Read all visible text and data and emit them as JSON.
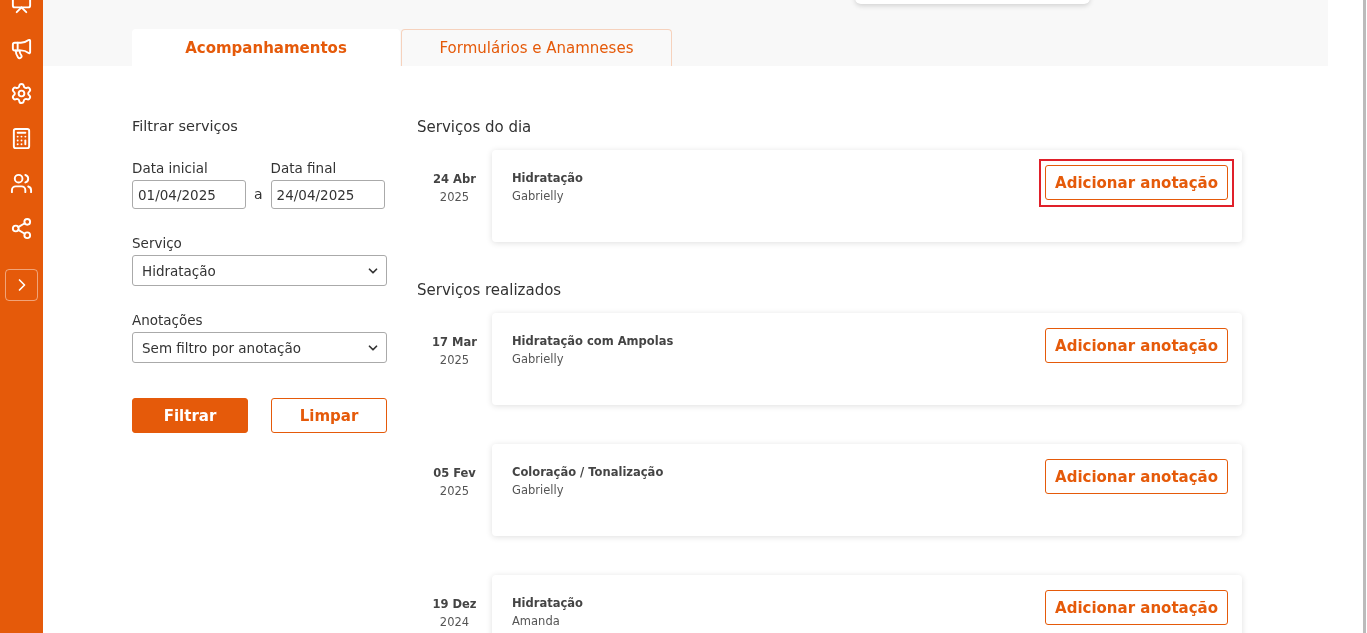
{
  "sidebar": {
    "items": [
      {
        "kind": "chart"
      },
      {
        "kind": "megaphone"
      },
      {
        "kind": "gear"
      },
      {
        "kind": "calculator"
      },
      {
        "kind": "users"
      },
      {
        "kind": "share"
      }
    ]
  },
  "tabs": [
    {
      "label": "Acompanhamentos",
      "selected": true
    },
    {
      "label": "Formulários e Anamneses",
      "selected": false
    }
  ],
  "filter": {
    "title": "Filtrar serviços",
    "start_label": "Data inicial",
    "start_value": "01/04/2025",
    "separator": "a",
    "end_label": "Data final",
    "end_value": "24/04/2025",
    "service_label": "Serviço",
    "service_value": "Hidratação",
    "notes_label": "Anotações",
    "notes_value": "Sem filtro por anotação",
    "filter_button": "Filtrar",
    "clear_button": "Limpar"
  },
  "sections": [
    {
      "title": "Serviços do dia",
      "items": [
        {
          "day": "24 Abr",
          "year": "2025",
          "service": "Hidratação",
          "professional": "Gabrielly",
          "action": "Adicionar anotação",
          "highlighted": true
        }
      ]
    },
    {
      "title": "Serviços realizados",
      "items": [
        {
          "day": "17 Mar",
          "year": "2025",
          "service": "Hidratação com Ampolas",
          "professional": "Gabrielly",
          "action": "Adicionar anotação",
          "highlighted": false
        },
        {
          "day": "05 Fev",
          "year": "2025",
          "service": "Coloração / Tonalização",
          "professional": "Gabrielly",
          "action": "Adicionar anotação",
          "highlighted": false
        },
        {
          "day": "19 Dez",
          "year": "2024",
          "service": "Hidratação",
          "professional": "Amanda",
          "action": "Adicionar anotação",
          "highlighted": false
        }
      ]
    }
  ]
}
